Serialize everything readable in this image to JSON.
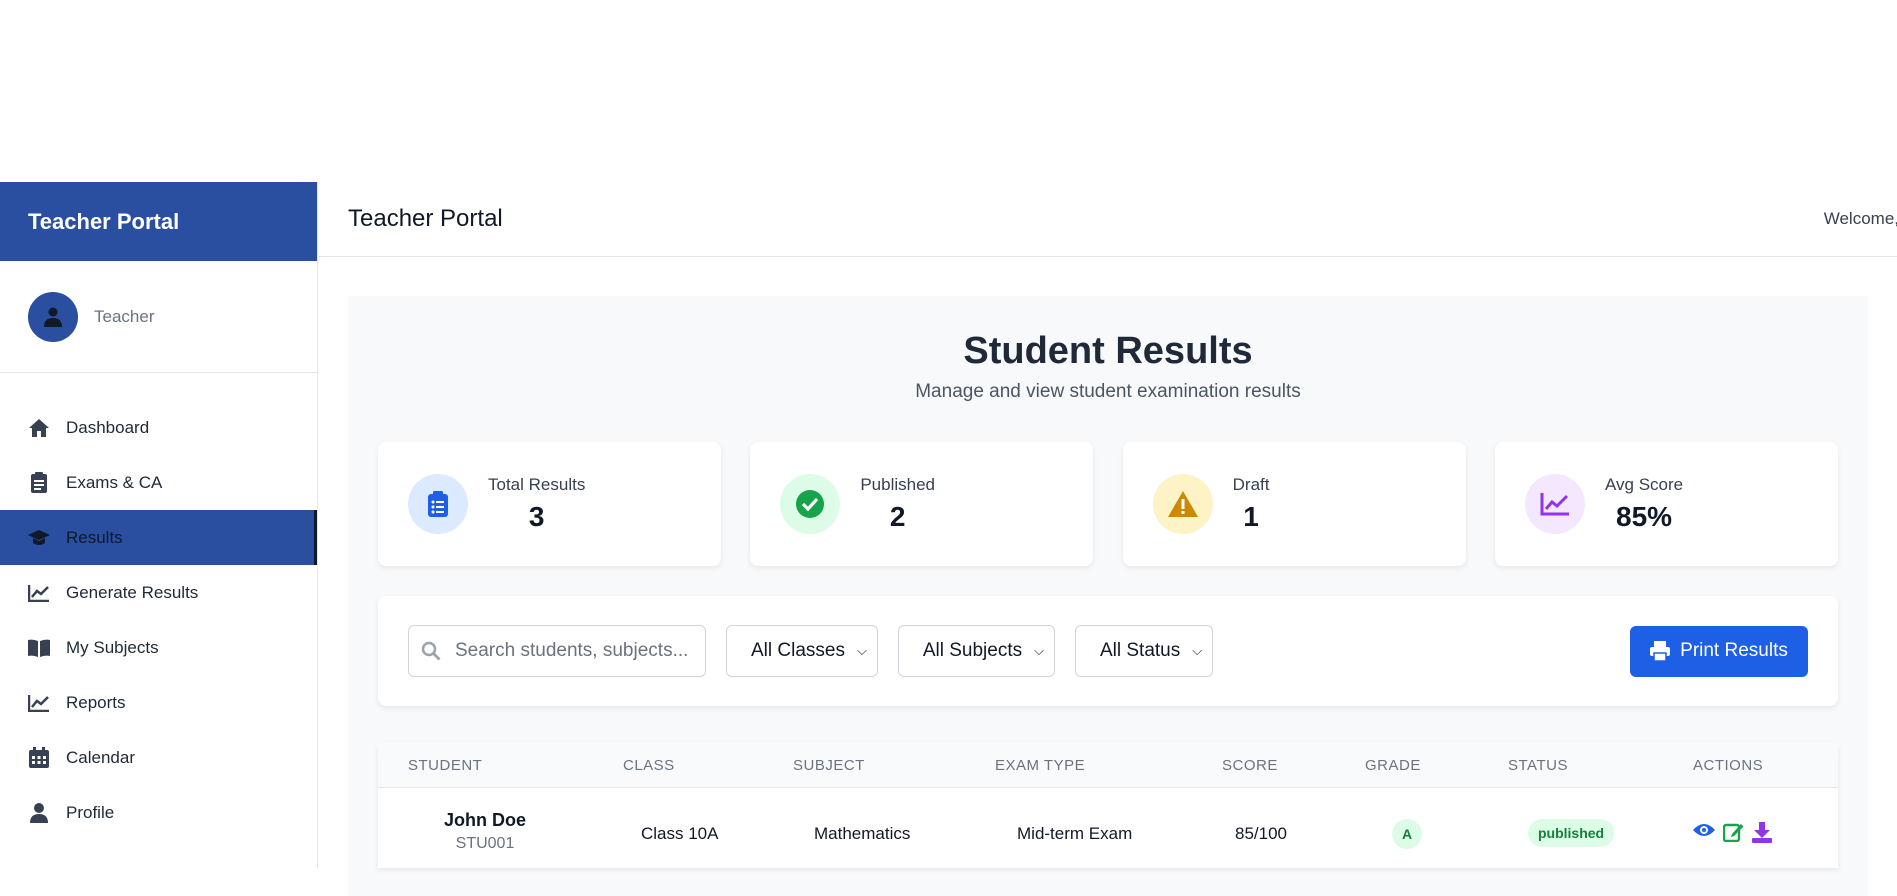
{
  "sidebar": {
    "title": "Teacher Portal",
    "user_role": "Teacher",
    "items": [
      {
        "label": "Dashboard",
        "icon": "home-icon"
      },
      {
        "label": "Exams & CA",
        "icon": "clipboard-icon"
      },
      {
        "label": "Results",
        "icon": "graduation-cap-icon",
        "active": true
      },
      {
        "label": "Generate Results",
        "icon": "chart-line-icon"
      },
      {
        "label": "My Subjects",
        "icon": "book-icon"
      },
      {
        "label": "Reports",
        "icon": "chart-line-icon"
      },
      {
        "label": "Calendar",
        "icon": "calendar-icon"
      },
      {
        "label": "Profile",
        "icon": "user-icon"
      }
    ]
  },
  "topbar": {
    "title": "Teacher Portal",
    "welcome": "Welcome,"
  },
  "page": {
    "title": "Student Results",
    "subtitle": "Manage and view student examination results"
  },
  "stats": [
    {
      "label": "Total Results",
      "value": "3",
      "icon": "clipboard-list-icon",
      "color": "#1d5fe5",
      "bg": "#dbeafe"
    },
    {
      "label": "Published",
      "value": "2",
      "icon": "check-circle-icon",
      "color": "#16a34a",
      "bg": "#dcfce7"
    },
    {
      "label": "Draft",
      "value": "1",
      "icon": "warning-icon",
      "color": "#ca8a04",
      "bg": "#fef3c7"
    },
    {
      "label": "Avg Score",
      "value": "85%",
      "icon": "chart-line-icon",
      "color": "#9333ea",
      "bg": "#f3e8ff"
    }
  ],
  "filters": {
    "search_placeholder": "Search students, subjects...",
    "classes": "All Classes",
    "subjects": "All Subjects",
    "status": "All Status",
    "print_label": "Print Results"
  },
  "table": {
    "headers": [
      "STUDENT",
      "CLASS",
      "SUBJECT",
      "EXAM TYPE",
      "SCORE",
      "GRADE",
      "STATUS",
      "ACTIONS"
    ],
    "rows": [
      {
        "name": "John Doe",
        "id": "STU001",
        "class": "Class 10A",
        "subject": "Mathematics",
        "exam_type": "Mid-term Exam",
        "score": "85/100",
        "grade": "A",
        "status": "published"
      }
    ]
  },
  "colors": {
    "primary": "#2a4ea0",
    "accent": "#1d5fe5"
  }
}
